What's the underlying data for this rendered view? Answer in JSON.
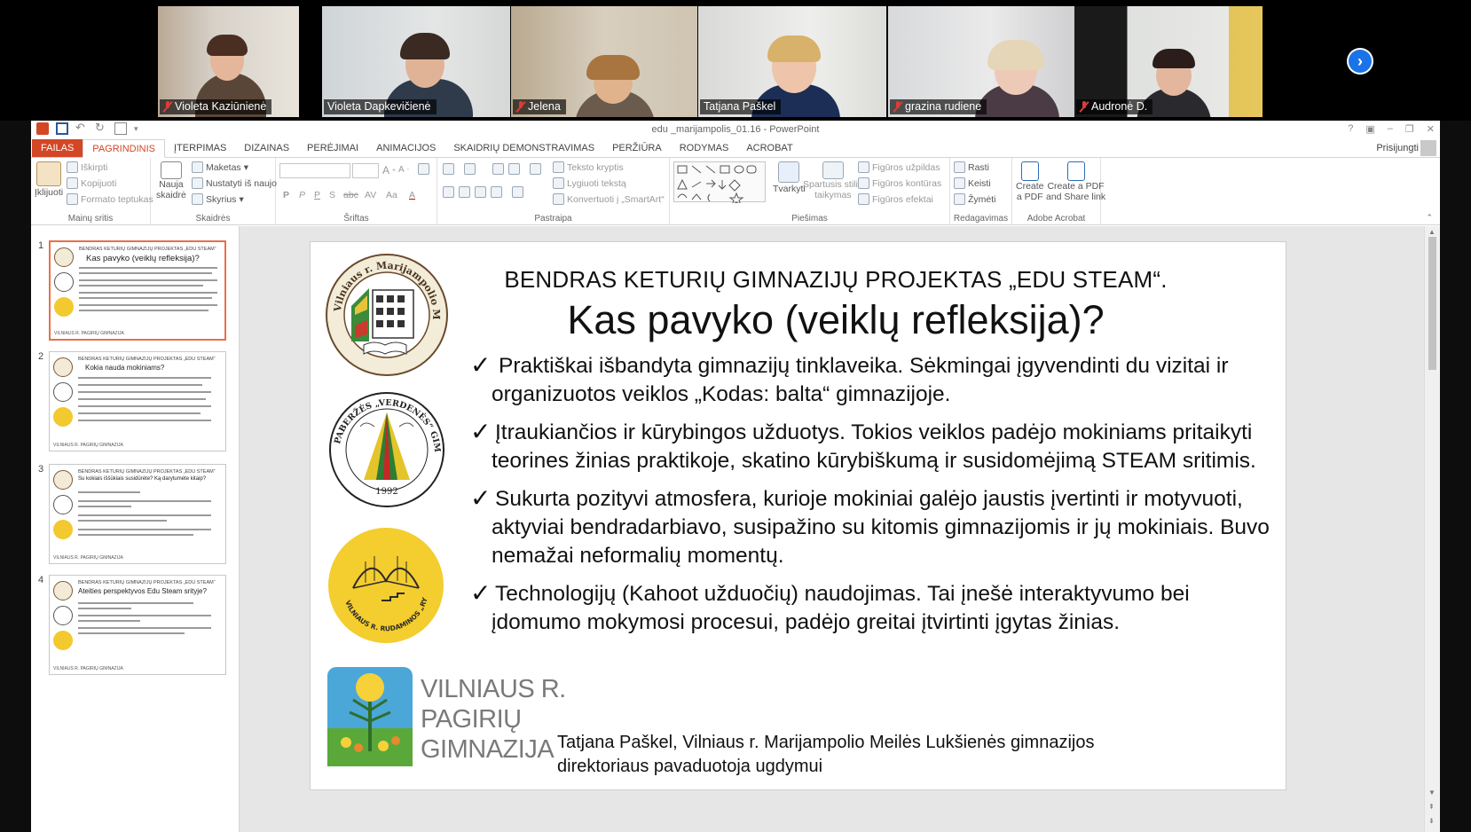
{
  "participants": [
    {
      "name": "Violeta Kaziūnienė",
      "muted": true
    },
    {
      "name": "Violeta Dapkevičienė",
      "muted": false
    },
    {
      "name": "Jelena",
      "muted": true
    },
    {
      "name": "Tatjana Paškel",
      "muted": false,
      "active": true
    },
    {
      "name": "grazina rudiene",
      "muted": true
    },
    {
      "name": "Audronė D.",
      "muted": true
    }
  ],
  "window": {
    "title": "edu _marijampolis_01.16 - PowerPoint",
    "signin": "Prisijungti"
  },
  "ribbon_tabs": [
    "FAILAS",
    "PAGRINDINIS",
    "ĮTERPIMAS",
    "DIZAINAS",
    "PERĖJIMAI",
    "ANIMACIJOS",
    "SKAIDRIŲ DEMONSTRAVIMAS",
    "PERŽIŪRA",
    "RODYMAS",
    "ACROBAT"
  ],
  "ribbon": {
    "clipboard": {
      "paste": "Įklijuoti",
      "cut": "Iškirpti",
      "copy": "Kopijuoti",
      "format_painter": "Formato teptukas",
      "label": "Mainų sritis"
    },
    "slides": {
      "new_slide_1": "Nauja",
      "new_slide_2": "skaidrė",
      "layout": "Maketas",
      "reset": "Nustatyti iš naujo",
      "section": "Skyrius",
      "label": "Skaidrės"
    },
    "font": {
      "label": "Šriftas",
      "bold": "P",
      "italic": "P",
      "underline": "P",
      "shadow": "S",
      "strike": "abc",
      "spacing": "AV",
      "case": "Aa",
      "color": "A"
    },
    "paragraph": {
      "text_direction": "Teksto kryptis",
      "align_text": "Lygiuoti tekstą",
      "smartart": "Konvertuoti į „SmartArt“",
      "label": "Pastraipa"
    },
    "drawing": {
      "arrange": "Tvarkyti",
      "quick_styles_1": "Spartusis stilių",
      "quick_styles_2": "taikymas",
      "shape_fill": "Figūros užpildas",
      "shape_outline": "Figūros kontūras",
      "shape_effects": "Figūros efektai",
      "label": "Piešimas"
    },
    "editing": {
      "find": "Rasti",
      "replace": "Keisti",
      "select": "Žymėti",
      "label": "Redagavimas"
    },
    "acrobat": {
      "create_pdf_1": "Create",
      "create_pdf_2": "a PDF",
      "share_1": "Create a PDF",
      "share_2": "and Share link",
      "label": "Adobe Acrobat"
    }
  },
  "thumbnails": [
    {
      "num": "1",
      "top": "BENDRAS KETURIŲ GIMNAZIJŲ PROJEKTAS „EDU STEAM“",
      "title": "Kas pavyko (veiklų refleksija)?"
    },
    {
      "num": "2",
      "top": "BENDRAS KETURIŲ GIMNAZIJŲ PROJEKTAS „EDU STEAM“",
      "title": "Kokia nauda mokiniams?"
    },
    {
      "num": "3",
      "top": "BENDRAS KETURIŲ GIMNAZIJŲ PROJEKTAS „EDU STEAM“",
      "title": "Su kokiais iššūkiais susidūrėte? Ką darytumėte kitaip?"
    },
    {
      "num": "4",
      "top": "BENDRAS KETURIŲ GIMNAZIJŲ PROJEKTAS „EDU STEAM“",
      "title": "Ateities perspektyvos Edu Steam srityje?"
    }
  ],
  "thumb_logo_text": "VILNIAUS R. PAGIRIŲ GIMNAZIJA",
  "slide": {
    "header": "BENDRAS KETURIŲ GIMNAZIJŲ PROJEKTAS „EDU STEAM“.",
    "title": "Kas pavyko (veiklų refleksija)?",
    "bullets": [
      {
        "check": "✓",
        "text": " Praktiškai išbandyta gimnazijų tinklaveika. Sėkmingai įgyvendinti du vizitai ir organizuotos veiklos „Kodas: balta“ gimnazijoje."
      },
      {
        "check": "✓",
        "text": "Įtraukiančios ir kūrybingos užduotys. Tokios veiklos padėjo mokiniams pritaikyti teorines žinias praktikoje, skatino kūrybiškumą ir susidomėjimą STEAM sritimis."
      },
      {
        "check": "✓",
        "text": "Sukurta pozityvi atmosfera, kurioje mokiniai galėjo jaustis įvertinti ir motyvuoti, aktyviai bendradarbiavo, susipažino su kitomis gimnazijomis ir jų mokiniais. Buvo nemažai neformalių momentų."
      },
      {
        "check": "✓",
        "text": "Technologijų (Kahoot užduočių) naudojimas. Tai įnešė interaktyvumo bei įdomumo mokymosi procesui, padėjo greitai įtvirtinti įgytas žinias."
      }
    ],
    "author_line1": "Tatjana Paškel, Vilniaus r. Marijampolio Meilės Lukšienės gimnazijos",
    "author_line2": "direktoriaus pavaduotoja ugdymui",
    "logos": {
      "marijampolis": "Vilniaus r. Marijampolio Meilės Lukšienės gimnazija",
      "verdenes": "PABERŽĖS „VERDENĖS“ GIMNAZIJA",
      "verdenes_year": "1992",
      "rytas": "VILNIAUS R. RUDAMINOS „RYTO“ GIMNAZIJA",
      "pagiriu_1": "VILNIAUS R.",
      "pagiriu_2": "PAGIRIŲ",
      "pagiriu_3": "GIMNAZIJA"
    }
  },
  "colors": {
    "accent": "#d24726",
    "active_speaker": "#2ecc71",
    "next_button": "#1a73e8"
  }
}
